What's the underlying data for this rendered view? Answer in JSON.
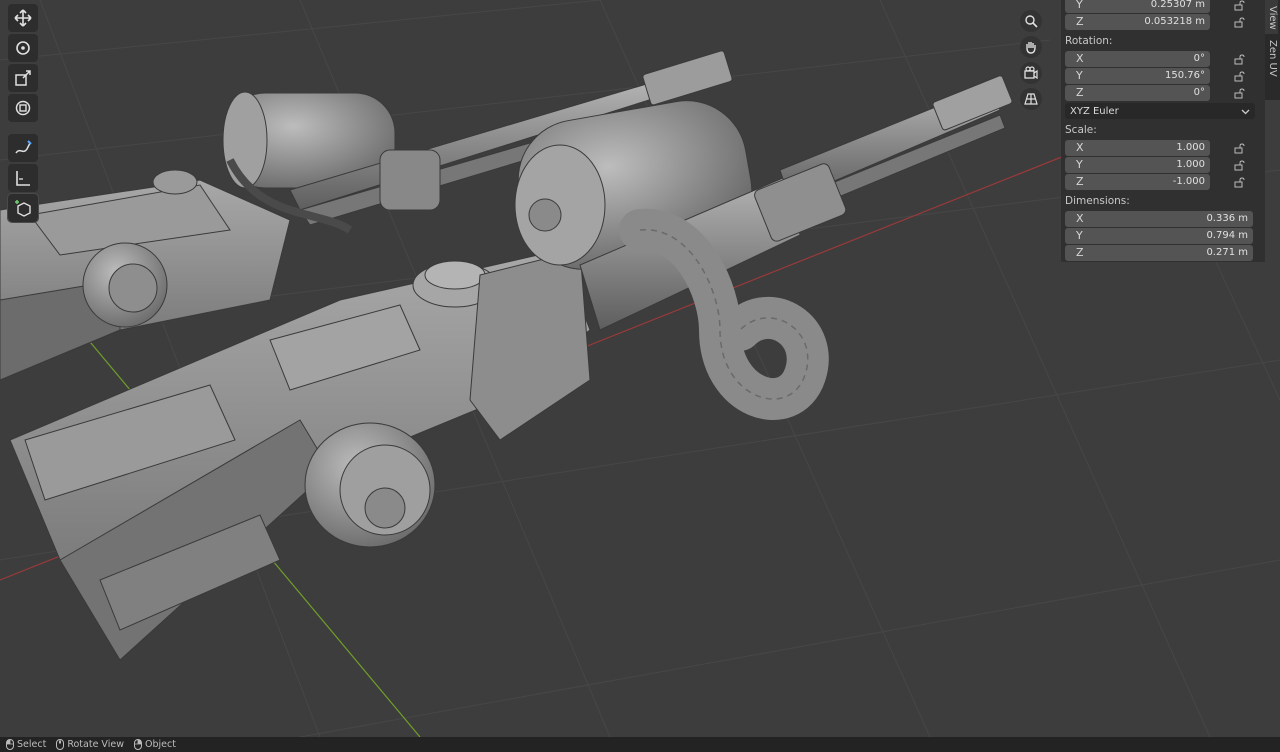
{
  "location": {
    "y": {
      "axis": "Y",
      "value": "0.25307 m"
    },
    "z": {
      "axis": "Z",
      "value": "0.053218 m"
    }
  },
  "rotation": {
    "label": "Rotation:",
    "x": {
      "axis": "X",
      "value": "0°"
    },
    "y": {
      "axis": "Y",
      "value": "150.76°"
    },
    "z": {
      "axis": "Z",
      "value": "0°"
    },
    "mode": "XYZ Euler"
  },
  "scale": {
    "label": "Scale:",
    "x": {
      "axis": "X",
      "value": "1.000"
    },
    "y": {
      "axis": "Y",
      "value": "1.000"
    },
    "z": {
      "axis": "Z",
      "value": "-1.000"
    }
  },
  "dimensions": {
    "label": "Dimensions:",
    "x": {
      "axis": "X",
      "value": "0.336 m"
    },
    "y": {
      "axis": "Y",
      "value": "0.794 m"
    },
    "z": {
      "axis": "Z",
      "value": "0.271 m"
    }
  },
  "side_tabs": [
    "View",
    "Zen UV"
  ],
  "toolbar": [
    "move-icon",
    "rotate-icon",
    "scale-icon",
    "transform-icon",
    "annotate-icon",
    "measure-icon",
    "add-cube-icon"
  ],
  "nav": [
    "zoom-icon",
    "pan-hand-icon",
    "camera-icon",
    "ortho-grid-icon"
  ],
  "status": {
    "select": "Select",
    "rotate": "Rotate View",
    "object": "Object"
  },
  "colors": {
    "background": "#3d3d3d",
    "panel": "#303030",
    "field": "#545454",
    "model": "#8a8a8a",
    "x_axis": "#a03a3a",
    "y_axis": "#6f9e2a"
  }
}
